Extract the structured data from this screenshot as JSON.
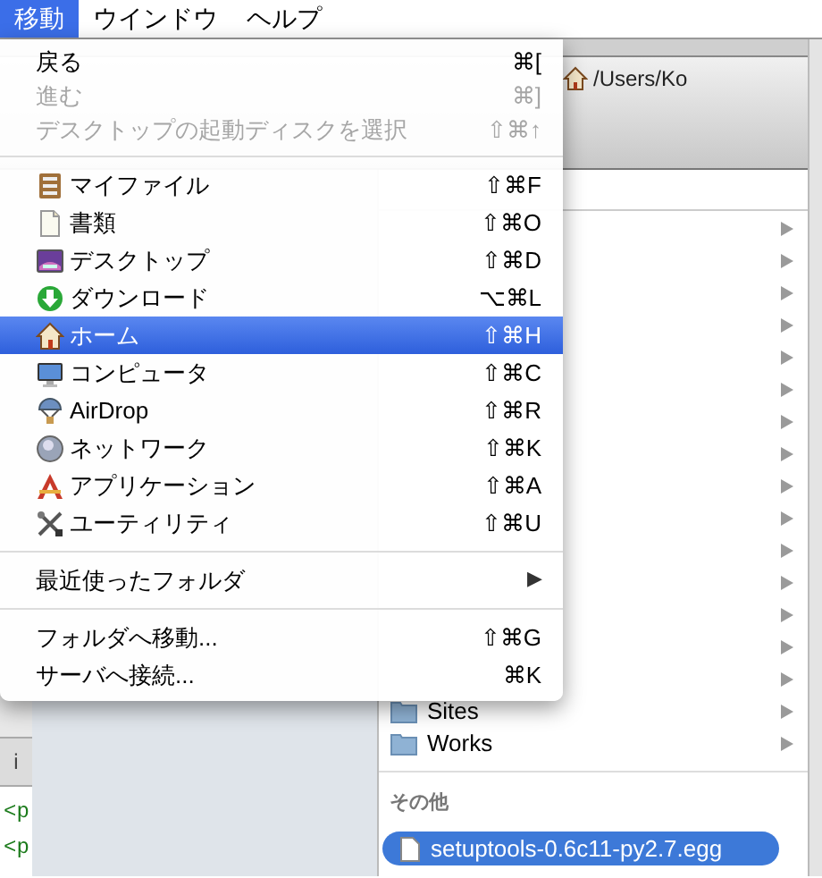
{
  "menubar": [
    {
      "label": "移動",
      "selected": true
    },
    {
      "label": "ウインドウ",
      "selected": false
    },
    {
      "label": "ヘルプ",
      "selected": false
    }
  ],
  "menu": [
    {
      "kind": "item",
      "label": "戻る",
      "shortcut": "⌘[",
      "disabled": false,
      "selected": false
    },
    {
      "kind": "item",
      "label": "進む",
      "shortcut": "⌘]",
      "disabled": true,
      "selected": false
    },
    {
      "kind": "item",
      "label": "デスクトップの起動ディスクを選択",
      "shortcut": "⇧⌘↑",
      "disabled": true,
      "selected": false
    },
    {
      "kind": "separator"
    },
    {
      "kind": "icon_item",
      "label": "マイファイル",
      "shortcut": "⇧⌘F",
      "disabled": false,
      "selected": false
    },
    {
      "kind": "icon_item",
      "label": "書類",
      "shortcut": "⇧⌘O",
      "disabled": false,
      "selected": false
    },
    {
      "kind": "icon_item",
      "label": "デスクトップ",
      "shortcut": "⇧⌘D",
      "disabled": false,
      "selected": false
    },
    {
      "kind": "icon_item",
      "label": "ダウンロード",
      "shortcut": "⌥⌘L",
      "disabled": false,
      "selected": false
    },
    {
      "kind": "icon_item",
      "label": "ホーム",
      "shortcut": "⇧⌘H",
      "disabled": false,
      "selected": true
    },
    {
      "kind": "icon_item",
      "label": "コンピュータ",
      "shortcut": "⇧⌘C",
      "disabled": false,
      "selected": false
    },
    {
      "kind": "icon_item",
      "label": "AirDrop",
      "shortcut": "⇧⌘R",
      "disabled": false,
      "selected": false
    },
    {
      "kind": "icon_item",
      "label": "ネットワーク",
      "shortcut": "⇧⌘K",
      "disabled": false,
      "selected": false
    },
    {
      "kind": "icon_item",
      "label": "アプリケーション",
      "shortcut": "⇧⌘A",
      "disabled": false,
      "selected": false
    },
    {
      "kind": "icon_item",
      "label": "ユーティリティ",
      "shortcut": "⇧⌘U",
      "disabled": false,
      "selected": false
    },
    {
      "kind": "separator"
    },
    {
      "kind": "submenu",
      "label": "最近使ったフォルダ",
      "shortcut": "▶",
      "disabled": false,
      "selected": false
    },
    {
      "kind": "separator"
    },
    {
      "kind": "item",
      "label": "フォルダへ移動...",
      "shortcut": "⇧⌘G",
      "disabled": false,
      "selected": false
    },
    {
      "kind": "item",
      "label": "サーバへ接続...",
      "shortcut": "⌘K",
      "disabled": false,
      "selected": false
    }
  ],
  "finder": {
    "path": "/Users/Ko",
    "rows": [
      {
        "kind": "covered"
      },
      {
        "kind": "covered"
      },
      {
        "kind": "covered"
      },
      {
        "kind": "covered"
      },
      {
        "kind": "covered"
      },
      {
        "kind": "covered"
      },
      {
        "kind": "covered"
      },
      {
        "kind": "covered"
      },
      {
        "kind": "covered"
      },
      {
        "kind": "covered"
      },
      {
        "kind": "covered"
      },
      {
        "kind": "covered"
      },
      {
        "kind": "covered"
      },
      {
        "kind": "covered"
      },
      {
        "kind": "covered"
      },
      {
        "kind": "folder",
        "name": "Sites"
      },
      {
        "kind": "folder",
        "name": "Works"
      }
    ],
    "section_title": "その他",
    "files": [
      {
        "name": "setuptools-0.6c11-py2.7.egg",
        "selected": true
      }
    ]
  },
  "editor": {
    "tab": "i",
    "lines": [
      "<p",
      "<p"
    ]
  }
}
